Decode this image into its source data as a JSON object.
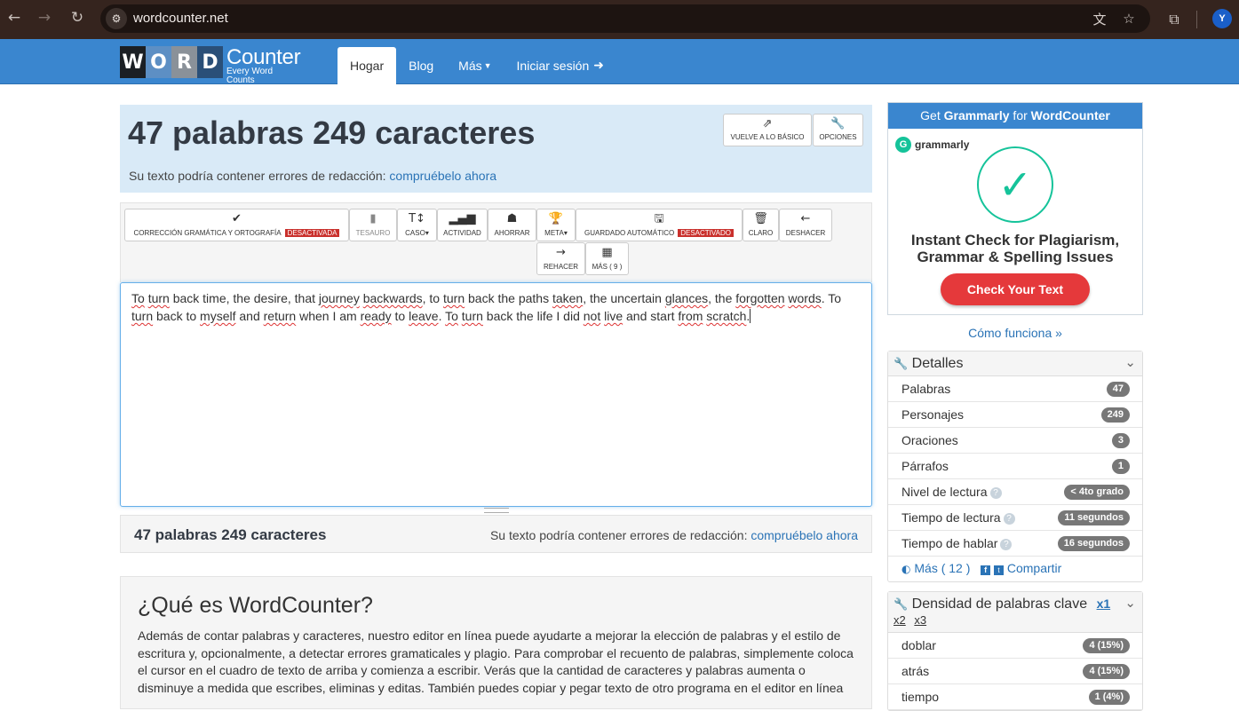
{
  "browser": {
    "url": "wordcounter.net",
    "profile_initial": "Y"
  },
  "site": {
    "logo_letters": [
      "W",
      "O",
      "R",
      "D"
    ],
    "logo_main": "Counter",
    "logo_sub": "Every Word Counts",
    "menu": {
      "home": "Hogar",
      "blog": "Blog",
      "more": "Más",
      "login": "Iniciar sesión"
    }
  },
  "counter": {
    "title": "47 palabras 249 caracteres",
    "error_text": "Su texto podría contener errores de redacción:",
    "error_link": "compruébelo ahora",
    "basic_button": "VUELVE A LO BÁSICO",
    "options_button": "OPCIONES"
  },
  "toolbar": {
    "grammar": "CORRECCIÓN GRAMÁTICA Y ORTOGRAFÍA",
    "grammar_status": "DESACTIVADA",
    "thesaurus": "TESAURO",
    "case": "CASO",
    "activity": "ACTIVIDAD",
    "save": "AHORRAR",
    "goal": "META",
    "autosave": "GUARDADO AUTOMÁTICO",
    "autosave_status": "DESACTIVADO",
    "clear": "CLARO",
    "undo": "DESHACER",
    "redo": "REHACER",
    "more": "MÁS ( 9 )"
  },
  "editor": {
    "text_parts": [
      "To",
      " ",
      "turn",
      " back time, the desire, that ",
      "journey",
      " ",
      "backwards",
      ", to ",
      "turn",
      " back the paths ",
      "taken",
      ", the uncertain ",
      "glances",
      ", the ",
      "forgotten",
      " ",
      "words",
      ". To ",
      "turn",
      " back to ",
      "myself",
      " and ",
      "return",
      " when I am ",
      "ready",
      " to ",
      "leave",
      ". ",
      "To",
      " ",
      "turn",
      " back the life I did ",
      "not",
      " ",
      "live",
      " and start ",
      "from",
      " ",
      "scratch",
      "."
    ]
  },
  "bottom": {
    "count": "47 palabras 249 caracteres",
    "error_text": "Su texto podría contener errores de redacción:",
    "error_link": "compruébelo ahora"
  },
  "about": {
    "title": "¿Qué es WordCounter?",
    "body": "Además de contar palabras y caracteres, nuestro editor en línea puede ayudarte a mejorar la elección de palabras y el estilo de escritura y, opcionalmente, a detectar errores gramaticales y plagio. Para comprobar el recuento de palabras, simplemente coloca el cursor en el cuadro de texto de arriba y comienza a escribir. Verás que la cantidad de caracteres y palabras aumenta o disminuye a medida que escribes, eliminas y editas. También puedes copiar y pegar texto de otro programa en el editor en línea"
  },
  "ad": {
    "header_prefix": "Get ",
    "header_brand": "Grammarly",
    "header_mid": " for ",
    "header_site": "WordCounter",
    "brand_small": "grammarly",
    "title_line1": "Instant Check for Plagiarism,",
    "title_line2": "Grammar & Spelling Issues",
    "button": "Check Your Text",
    "how_link": "Cómo funciona »"
  },
  "details": {
    "title": "Detalles",
    "rows": [
      {
        "label": "Palabras",
        "value": "47"
      },
      {
        "label": "Personajes",
        "value": "249"
      },
      {
        "label": "Oraciones",
        "value": "3"
      },
      {
        "label": "Párrafos",
        "value": "1"
      },
      {
        "label": "Nivel de lectura",
        "value": "< 4to grado"
      },
      {
        "label": "Tiempo de lectura",
        "value": "11 segundos"
      },
      {
        "label": "Tiempo de hablar",
        "value": "16 segundos"
      }
    ],
    "more_link": "Más ( 12 )",
    "share_link": "Compartir"
  },
  "density": {
    "title": "Densidad de palabras clave",
    "x1": "x1",
    "x2": "x2",
    "x3": "x3",
    "rows": [
      {
        "label": "doblar",
        "value": "4 (15%)"
      },
      {
        "label": "atrás",
        "value": "4 (15%)"
      },
      {
        "label": "tiempo",
        "value": "1 (4%)"
      }
    ]
  }
}
